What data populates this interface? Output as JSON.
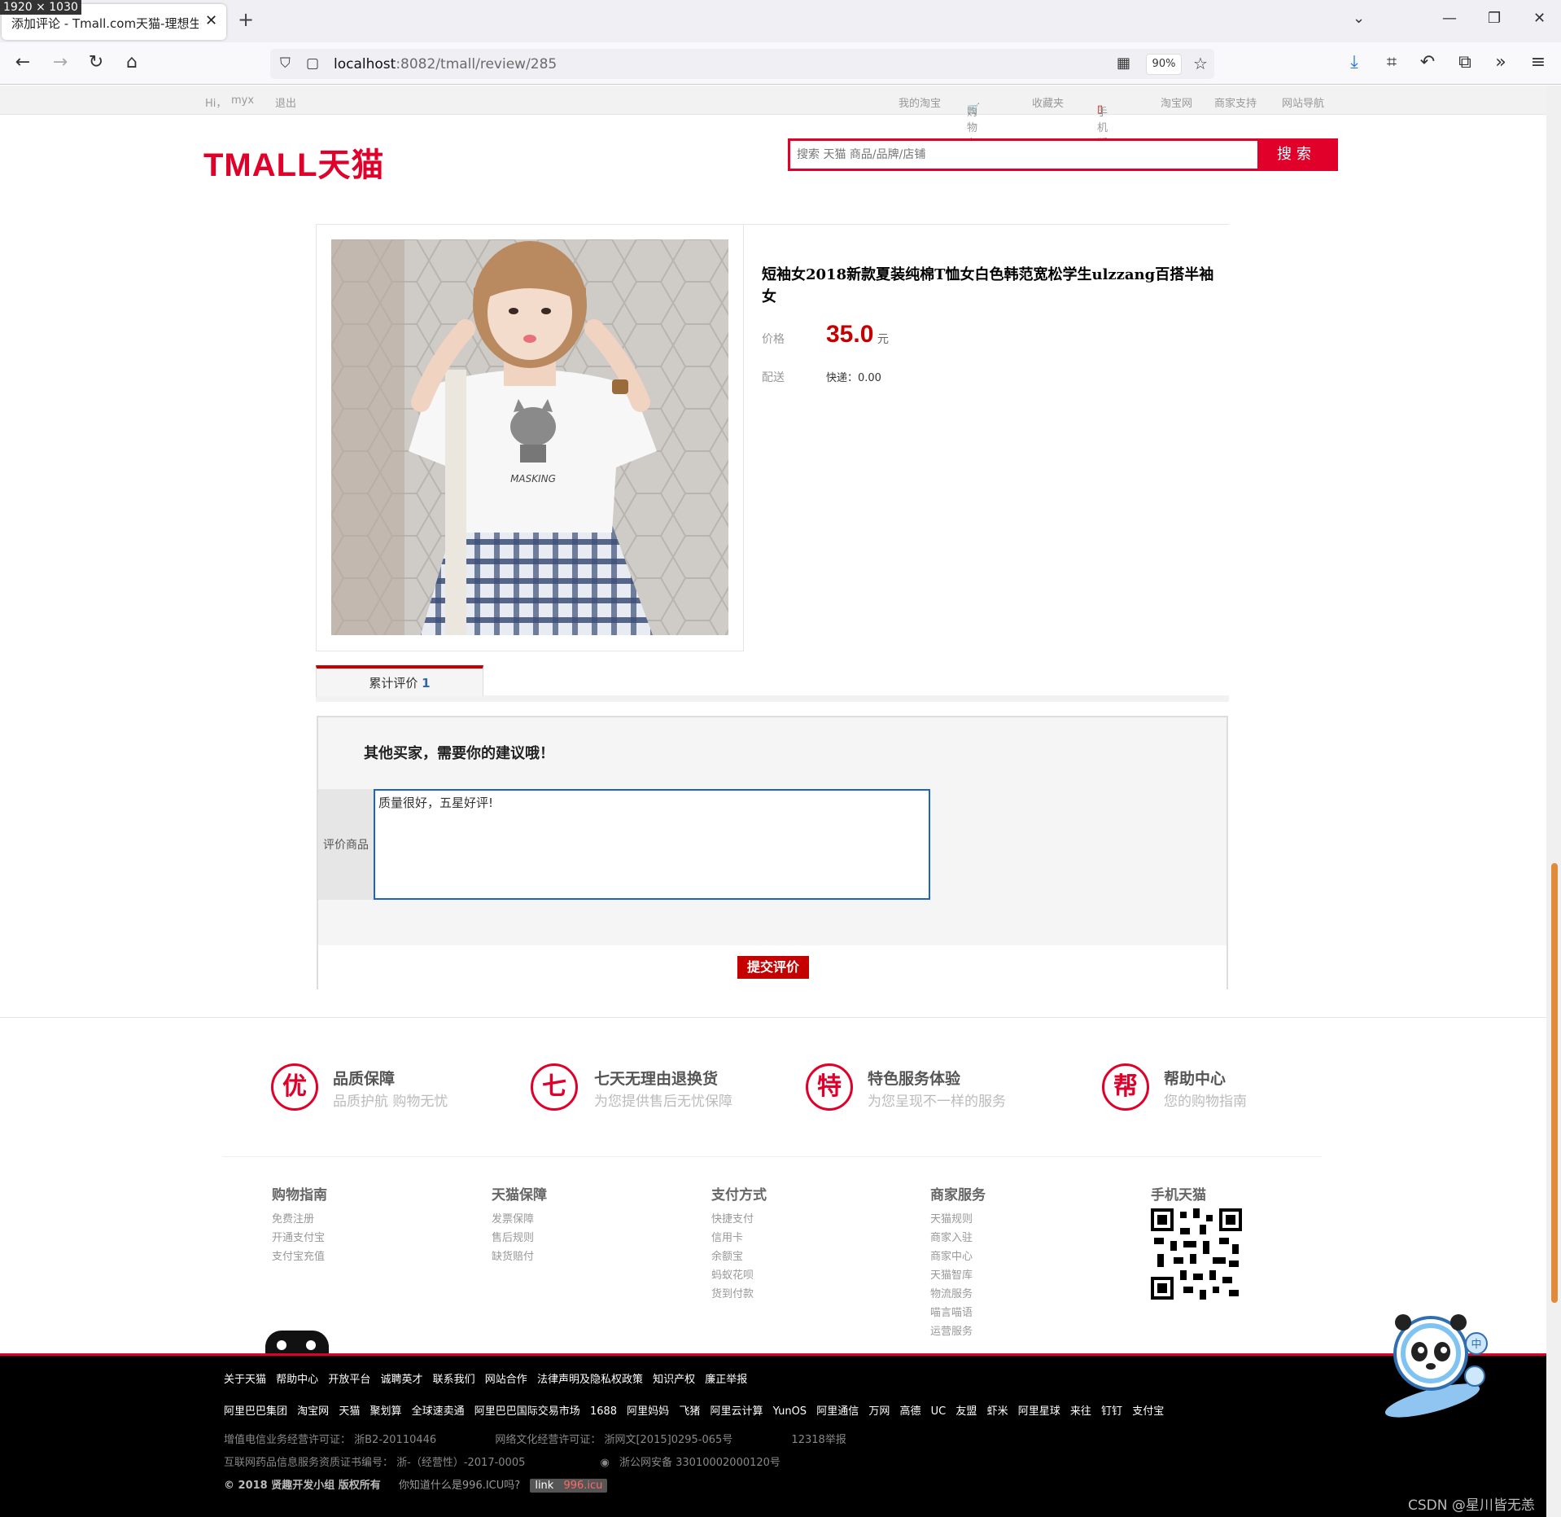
{
  "browser": {
    "dimension_badge": "1920 × 1030",
    "tab_title": "添加评论 - Tmall.com天猫-理想生活",
    "url_host": "localhost",
    "url_path": ":8082/tmall/review/285",
    "zoom": "90%"
  },
  "site_top": {
    "greeting": "Hi，",
    "username": "myx",
    "logout": "退出",
    "my_taobao": "我的淘宝",
    "cart": "购物车",
    "favorites": "收藏夹",
    "mobile": "手机版",
    "taobao": "淘宝网",
    "merchant_support": "商家支持",
    "site_nav": "网站导航"
  },
  "header": {
    "logo_text": "TMALL天猫",
    "search_placeholder": "搜索 天猫 商品/品牌/店铺",
    "search_button": "搜索"
  },
  "product": {
    "name": "短袖女2018新款夏装纯棉T恤女白色韩范宽松学生ulzzang百搭半袖女",
    "price_label": "价格",
    "price": "35.0",
    "currency": "元",
    "shipping_label": "配送",
    "shipping_value": "快递：0.00",
    "shirt_text": "MASKING"
  },
  "tabs": {
    "review_label": "累计评价",
    "review_count": "1"
  },
  "review_form": {
    "title": "其他买家，需要你的建议哦！",
    "field_label": "评价商品",
    "text": "质量很好，五星好评!",
    "submit": "提交评价"
  },
  "guarantees": [
    {
      "icon": "优",
      "title": "品质保障",
      "subtitle": "品质护航 购物无忧"
    },
    {
      "icon": "七",
      "title": "七天无理由退换货",
      "subtitle": "为您提供售后无忧保障"
    },
    {
      "icon": "特",
      "title": "特色服务体验",
      "subtitle": "为您呈现不一样的服务"
    },
    {
      "icon": "帮",
      "title": "帮助中心",
      "subtitle": "您的购物指南"
    }
  ],
  "footer_columns": [
    {
      "heading": "购物指南",
      "items": [
        "免费注册",
        "开通支付宝",
        "支付宝充值"
      ]
    },
    {
      "heading": "天猫保障",
      "items": [
        "发票保障",
        "售后规则",
        "缺货赔付"
      ]
    },
    {
      "heading": "支付方式",
      "items": [
        "快捷支付",
        "信用卡",
        "余额宝",
        "蚂蚁花呗",
        "货到付款"
      ]
    },
    {
      "heading": "商家服务",
      "items": [
        "天猫规则",
        "商家入驻",
        "商家中心",
        "天猫智库",
        "物流服务",
        "喵言喵语",
        "运营服务"
      ]
    },
    {
      "heading": "手机天猫",
      "items": []
    }
  ],
  "bottom_links": [
    "关于天猫",
    "帮助中心",
    "开放平台",
    "诚聘英才",
    "联系我们",
    "网站合作",
    "法律声明及隐私权政策",
    "知识产权",
    "廉正举报"
  ],
  "partner_links": [
    "阿里巴巴集团",
    "淘宝网",
    "天猫",
    "聚划算",
    "全球速卖通",
    "阿里巴巴国际交易市场",
    "1688",
    "阿里妈妈",
    "飞猪",
    "阿里云计算",
    "YunOS",
    "阿里通信",
    "万网",
    "高德",
    "UC",
    "友盟",
    "虾米",
    "阿里星球",
    "来往",
    "钉钉",
    "支付宝"
  ],
  "legal": {
    "line1_a": "增值电信业务经营许可证： 浙B2-20110446",
    "line1_b": "网络文化经营许可证： 浙网文[2015]0295-065号",
    "line1_c": "12318举报",
    "line2_a": "互联网药品信息服务资质证书编号： 浙-（经营性）-2017-0005",
    "line2_b": "浙公网安备 33010002000120号",
    "copyright": "© 2018 贤趣开发小组 版权所有",
    "question": "你知道什么是996.ICU吗?",
    "link_label": "link",
    "link_value": "996.icu"
  },
  "watermark": "CSDN @星川皆无恙",
  "mascot_badge": "中"
}
